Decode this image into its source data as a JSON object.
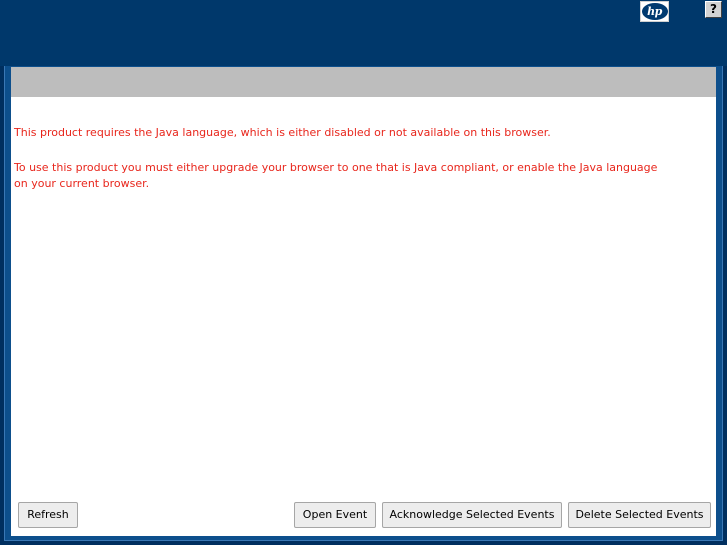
{
  "header": {
    "logo_text": "hp",
    "help_label": "?"
  },
  "messages": {
    "java_required": "This product requires the Java language, which is either disabled or not available on this browser.",
    "java_instructions": "To use this product you must either upgrade your browser to one that is Java compliant, or enable the Java language on your current browser."
  },
  "buttons": {
    "refresh": "Refresh",
    "open_event": "Open Event",
    "acknowledge": "Acknowledge Selected Events",
    "delete": "Delete Selected Events"
  },
  "colors": {
    "background": "#00386b",
    "panel_header": "#bdbdbd",
    "message_text": "#e8261c"
  }
}
